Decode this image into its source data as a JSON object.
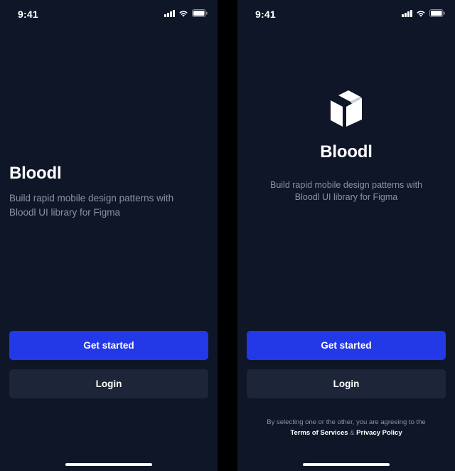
{
  "screens": [
    {
      "status": {
        "time": "9:41"
      },
      "title": "Bloodl",
      "tagline": "Build rapid mobile design patterns with Bloodl UI library for Figma",
      "primary_label": "Get started",
      "secondary_label": "Login"
    },
    {
      "status": {
        "time": "9:41"
      },
      "logo_icon": "cube-icon",
      "title": "Bloodl",
      "tagline": "Build rapid mobile design patterns with Bloodl UI library for Figma",
      "primary_label": "Get started",
      "secondary_label": "Login",
      "consent": {
        "text": "By selecting one or the other, you are agreeing to the",
        "terms_link": "Terms of Services",
        "separator": "&",
        "privacy_link": "Privacy Policy"
      }
    }
  ],
  "colors": {
    "background": "#0e1628",
    "primary_button": "#2338e6",
    "secondary_button": "#1c2638",
    "muted_text": "#8a93a6",
    "text": "#ffffff"
  },
  "icons": {
    "signal": "cellular-signal-icon",
    "wifi": "wifi-icon",
    "battery": "battery-icon"
  }
}
